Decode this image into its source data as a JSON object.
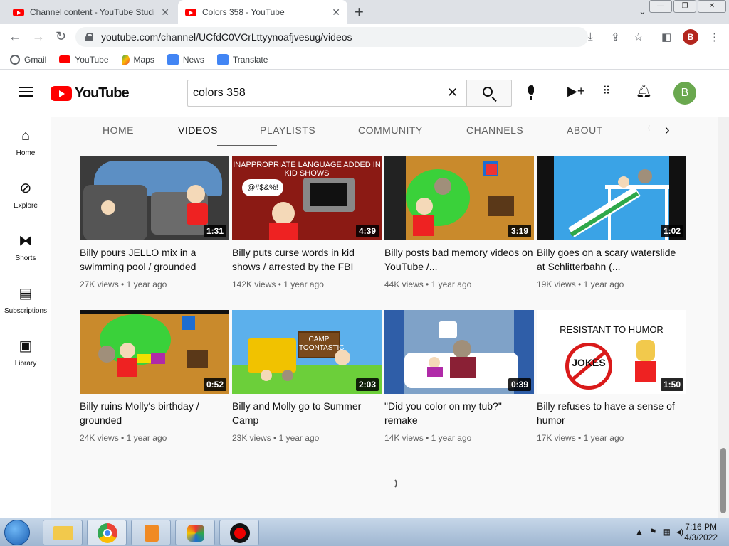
{
  "browser": {
    "tabs": [
      {
        "title": "Channel content - YouTube Studi",
        "active": false
      },
      {
        "title": "Colors 358 - YouTube",
        "active": true
      }
    ],
    "url": "youtube.com/channel/UCfdC0VCrLttyynoafjvesug/videos",
    "profile_initial": "B",
    "bookmarks": [
      "Gmail",
      "YouTube",
      "Maps",
      "News",
      "Translate"
    ]
  },
  "youtube": {
    "logo_text": "YouTube",
    "search_value": "colors 358",
    "avatar_initial": "B",
    "sidebar": [
      "Home",
      "Explore",
      "Shorts",
      "Subscriptions",
      "Library"
    ],
    "channel_tabs": [
      "HOME",
      "VIDEOS",
      "PLAYLISTS",
      "COMMUNITY",
      "CHANNELS",
      "ABOUT"
    ],
    "active_tab": "VIDEOS",
    "videos": [
      {
        "title": "Billy pours JELLO mix in a swimming pool / grounded",
        "duration": "1:31",
        "views": "27K views",
        "age": "1 year ago"
      },
      {
        "title": "Billy puts curse words in kid shows / arrested by the FBI",
        "duration": "4:39",
        "views": "142K views",
        "age": "1 year ago",
        "thumb_text_1": "INAPPROPRIATE LANGUAGE ADDED IN KID SHOWS",
        "thumb_text_2": "@#$&%!"
      },
      {
        "title": "Billy posts bad memory videos on YouTube /...",
        "duration": "3:19",
        "views": "44K views",
        "age": "1 year ago"
      },
      {
        "title": "Billy goes on a scary waterslide at Schlitterbahn (...",
        "duration": "1:02",
        "views": "19K views",
        "age": "1 year ago"
      },
      {
        "title": "Billy ruins Molly's birthday / grounded",
        "duration": "0:52",
        "views": "24K views",
        "age": "1 year ago"
      },
      {
        "title": "Billy and Molly go to Summer Camp",
        "duration": "2:03",
        "views": "23K views",
        "age": "1 year ago",
        "thumb_text_1": "CAMP TOONTASTIC"
      },
      {
        "title": "\"Did you color on my tub?\" remake",
        "duration": "0:39",
        "views": "14K views",
        "age": "1 year ago"
      },
      {
        "title": "Billy refuses to have a sense of humor",
        "duration": "1:50",
        "views": "17K views",
        "age": "1 year ago",
        "thumb_text_1": "RESISTANT TO HUMOR",
        "thumb_text_2": "JOKES"
      }
    ]
  },
  "taskbar": {
    "time": "7:16 PM",
    "date": "4/3/2022"
  },
  "colors": {
    "youtube_red": "#ff0000",
    "avatar_green": "#6aa84f",
    "profile_red": "#b3261e"
  }
}
